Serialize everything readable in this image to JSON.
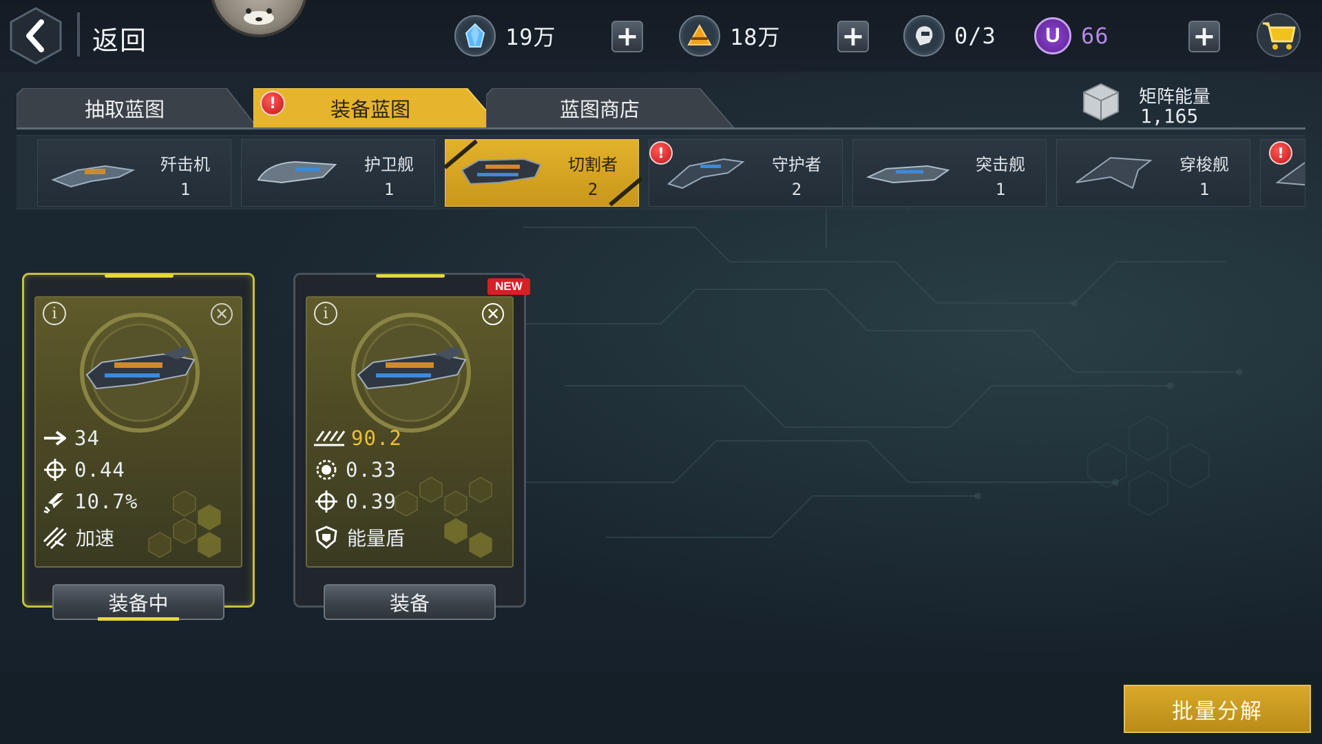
{
  "header": {
    "back_label": "返回",
    "resources": [
      {
        "name": "crystal",
        "icon": "crystal-icon",
        "value": "19万",
        "color": "#4aa8f0"
      },
      {
        "name": "gold",
        "icon": "gold-pyramid-icon",
        "value": "18万",
        "color": "#f0a020"
      },
      {
        "name": "pilots",
        "icon": "pilot-helmet-icon",
        "value": "0/3",
        "color": "#d8dde2"
      },
      {
        "name": "u-currency",
        "icon": "u-coin-icon",
        "value": "66",
        "color": "#8a3fd0"
      }
    ]
  },
  "tabs": [
    {
      "label": "抽取蓝图",
      "active": false
    },
    {
      "label": "装备蓝图",
      "active": true,
      "badge": "!"
    },
    {
      "label": "蓝图商店",
      "active": false
    }
  ],
  "matrix_energy": {
    "label": "矩阵能量",
    "value": "1,165"
  },
  "categories": [
    {
      "name": "歼击机",
      "count": "1",
      "selected": false
    },
    {
      "name": "护卫舰",
      "count": "1",
      "selected": false
    },
    {
      "name": "切割者",
      "count": "2",
      "selected": true
    },
    {
      "name": "守护者",
      "count": "2",
      "selected": false,
      "badge": "!"
    },
    {
      "name": "突击舰",
      "count": "1",
      "selected": false
    },
    {
      "name": "穿梭舰",
      "count": "1",
      "selected": false
    },
    {
      "name": "",
      "count": "",
      "selected": false,
      "badge": "!"
    }
  ],
  "cards": [
    {
      "status": "equipped",
      "stats": [
        {
          "icon": "arrow-speed-icon",
          "value": "34"
        },
        {
          "icon": "crosshair-icon",
          "value": "0.44"
        },
        {
          "icon": "missile-icon",
          "value": "10.7%"
        }
      ],
      "skill": {
        "icon": "boost-icon",
        "label": "加速"
      },
      "button_label": "装备中"
    },
    {
      "status": "new",
      "new_label": "NEW",
      "stats": [
        {
          "icon": "multi-shot-icon",
          "value": "90.2",
          "highlight": true
        },
        {
          "icon": "gear-target-icon",
          "value": "0.33"
        },
        {
          "icon": "crosshair-icon",
          "value": "0.39"
        }
      ],
      "skill": {
        "icon": "shield-icon",
        "label": "能量盾"
      },
      "button_label": "装备"
    }
  ],
  "bulk_button_label": "批量分解",
  "colors": {
    "accent_gold": "#e0ad28",
    "highlight_value": "#f0bf38",
    "badge_red": "#d81f24"
  }
}
